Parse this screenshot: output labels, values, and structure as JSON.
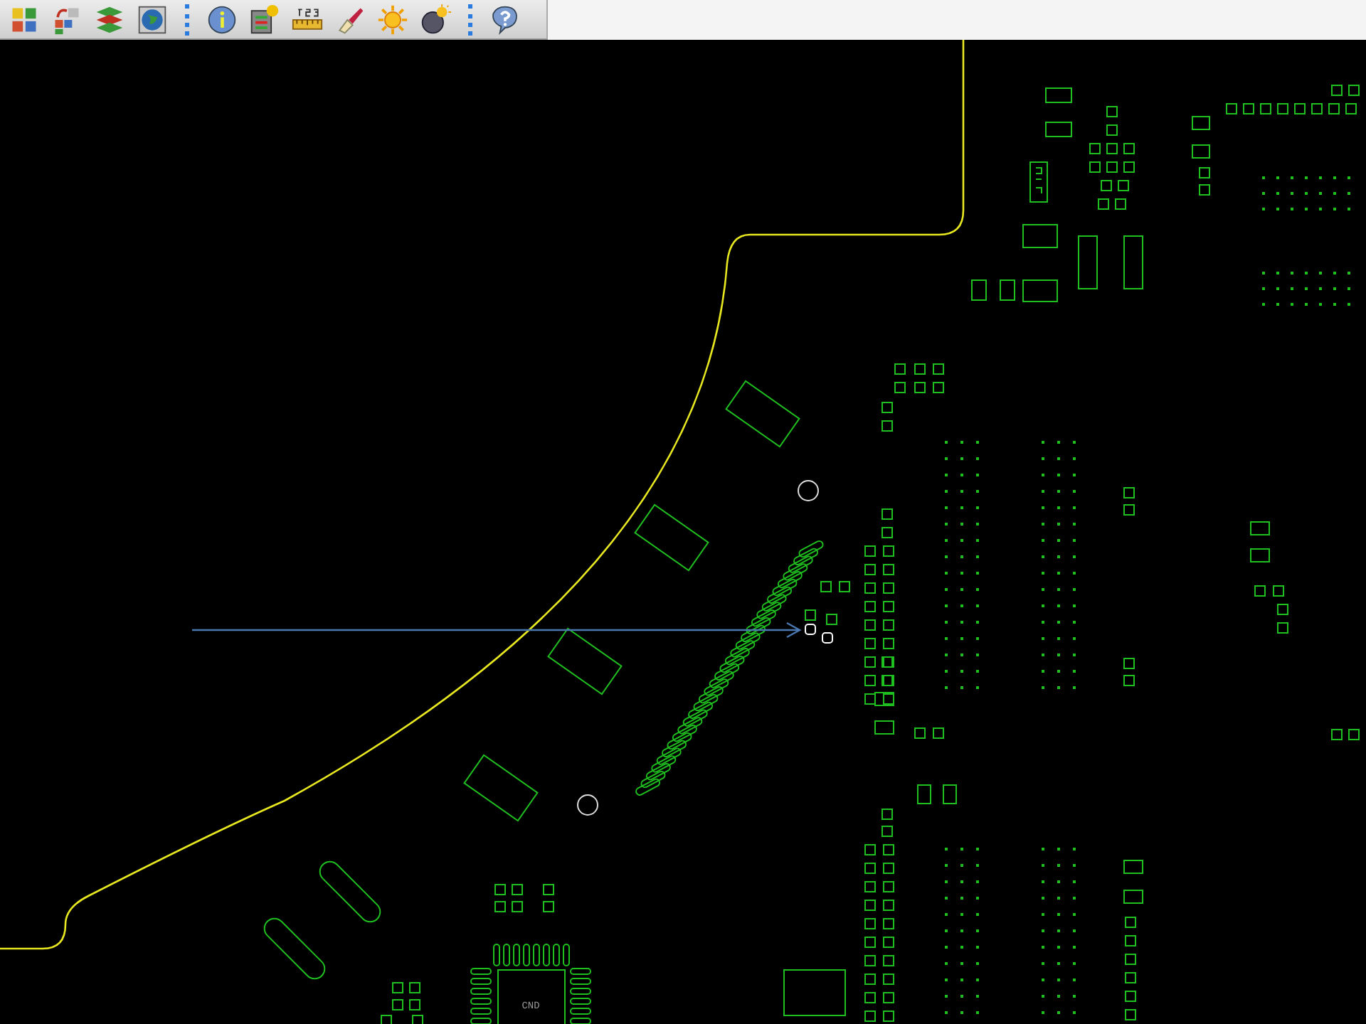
{
  "toolbar": [
    {
      "kind": "layers"
    },
    {
      "kind": "swap"
    },
    {
      "kind": "stack"
    },
    {
      "kind": "globe"
    },
    {
      "kind": "separator"
    },
    {
      "kind": "info"
    },
    {
      "kind": "table"
    },
    {
      "kind": "ruler"
    },
    {
      "kind": "brush"
    },
    {
      "kind": "sun"
    },
    {
      "kind": "bulb"
    },
    {
      "kind": "separator"
    },
    {
      "kind": "help"
    }
  ],
  "board": {
    "labels": [
      {
        "text": "CND"
      }
    ]
  }
}
